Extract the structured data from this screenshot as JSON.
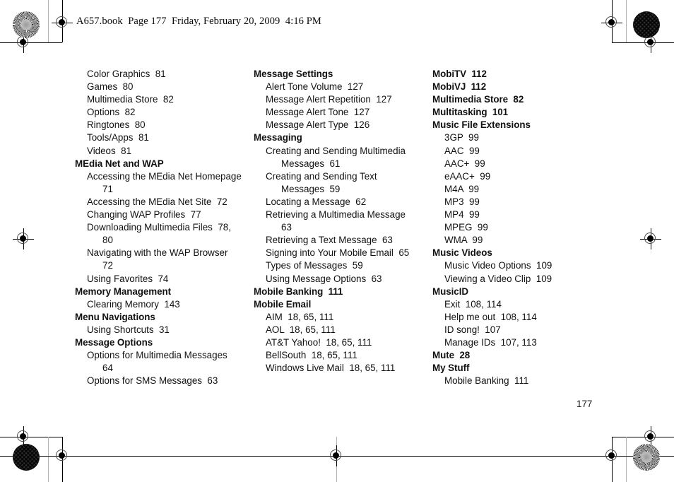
{
  "document": {
    "header_line": "A657.book  Page 177  Friday, February 20, 2009  4:16 PM",
    "page_number": "177"
  },
  "index": {
    "columns": [
      {
        "id": "column-1",
        "entries": [
          {
            "type": "sub",
            "text": "Color Graphics  81"
          },
          {
            "type": "sub",
            "text": "Games  80"
          },
          {
            "type": "sub",
            "text": "Multimedia Store  82"
          },
          {
            "type": "sub",
            "text": "Options  82"
          },
          {
            "type": "sub",
            "text": "Ringtones  80"
          },
          {
            "type": "sub",
            "text": "Tools/Apps  81"
          },
          {
            "type": "sub",
            "text": "Videos  81"
          },
          {
            "type": "heading",
            "text": "MEdia Net and WAP"
          },
          {
            "type": "sub",
            "text": "Accessing the MEdia Net Homepage",
            "cont": "71"
          },
          {
            "type": "sub",
            "text": "Accessing the MEdia Net Site  72"
          },
          {
            "type": "sub",
            "text": "Changing WAP Profiles  77"
          },
          {
            "type": "sub",
            "text": "Downloading Multimedia Files  78,",
            "cont": "80"
          },
          {
            "type": "sub",
            "text": "Navigating with the WAP Browser",
            "cont": "72"
          },
          {
            "type": "sub",
            "text": "Using Favorites  74"
          },
          {
            "type": "heading",
            "text": "Memory Management"
          },
          {
            "type": "sub",
            "text": "Clearing Memory  143"
          },
          {
            "type": "heading",
            "text": "Menu Navigations"
          },
          {
            "type": "sub",
            "text": "Using Shortcuts  31"
          },
          {
            "type": "heading",
            "text": "Message Options"
          },
          {
            "type": "sub",
            "text": "Options for Multimedia Messages",
            "cont": "64"
          },
          {
            "type": "sub",
            "text": "Options for SMS Messages  63"
          }
        ]
      },
      {
        "id": "column-2",
        "entries": [
          {
            "type": "heading",
            "text": "Message Settings"
          },
          {
            "type": "sub",
            "text": "Alert Tone Volume  127"
          },
          {
            "type": "sub",
            "text": "Message Alert Repetition  127"
          },
          {
            "type": "sub",
            "text": "Message Alert Tone  127"
          },
          {
            "type": "sub",
            "text": "Message Alert Type  126"
          },
          {
            "type": "heading",
            "text": "Messaging"
          },
          {
            "type": "sub",
            "text": "Creating and Sending Multimedia",
            "cont": "Messages  61"
          },
          {
            "type": "sub",
            "text": "Creating and Sending Text",
            "cont": "Messages  59"
          },
          {
            "type": "sub",
            "text": "Locating a Message  62"
          },
          {
            "type": "sub",
            "text": "Retrieving a Multimedia Message",
            "cont": "63"
          },
          {
            "type": "sub",
            "text": "Retrieving a Text Message  63"
          },
          {
            "type": "sub",
            "text": "Signing into Your Mobile Email  65"
          },
          {
            "type": "sub",
            "text": "Types of Messages  59"
          },
          {
            "type": "sub",
            "text": "Using Message Options  63"
          },
          {
            "type": "heading",
            "text": "Mobile Banking  111"
          },
          {
            "type": "heading",
            "text": "Mobile Email"
          },
          {
            "type": "sub",
            "text": "AIM  18, 65, 111"
          },
          {
            "type": "sub",
            "text": "AOL  18, 65, 111"
          },
          {
            "type": "sub",
            "text": "AT&T Yahoo!  18, 65, 111"
          },
          {
            "type": "sub",
            "text": "BellSouth  18, 65, 111"
          },
          {
            "type": "sub",
            "text": "Windows Live Mail  18, 65, 111"
          }
        ]
      },
      {
        "id": "column-3",
        "entries": [
          {
            "type": "heading",
            "text": "MobiTV  112"
          },
          {
            "type": "heading",
            "text": "MobiVJ  112"
          },
          {
            "type": "heading",
            "text": "Multimedia Store  82"
          },
          {
            "type": "heading",
            "text": "Multitasking  101"
          },
          {
            "type": "heading",
            "text": "Music File Extensions"
          },
          {
            "type": "sub",
            "text": "3GP  99"
          },
          {
            "type": "sub",
            "text": "AAC  99"
          },
          {
            "type": "sub",
            "text": "AAC+  99"
          },
          {
            "type": "sub",
            "text": "eAAC+  99"
          },
          {
            "type": "sub",
            "text": "M4A  99"
          },
          {
            "type": "sub",
            "text": "MP3  99"
          },
          {
            "type": "sub",
            "text": "MP4  99"
          },
          {
            "type": "sub",
            "text": "MPEG  99"
          },
          {
            "type": "sub",
            "text": "WMA  99"
          },
          {
            "type": "heading",
            "text": "Music Videos"
          },
          {
            "type": "sub",
            "text": "Music Video Options  109"
          },
          {
            "type": "sub",
            "text": "Viewing a Video Clip  109"
          },
          {
            "type": "heading",
            "text": "MusicID"
          },
          {
            "type": "sub",
            "text": "Exit  108, 114"
          },
          {
            "type": "sub",
            "text": "Help me out  108, 114"
          },
          {
            "type": "sub",
            "text": "ID song!  107"
          },
          {
            "type": "sub",
            "text": "Manage IDs  107, 113"
          },
          {
            "type": "heading",
            "text": "Mute  28"
          },
          {
            "type": "heading",
            "text": "My Stuff"
          },
          {
            "type": "sub",
            "text": "Mobile Banking  111"
          }
        ]
      }
    ]
  },
  "print_marks": {
    "registration_label": "registration-target",
    "star_label": "star-density-target",
    "maze_label": "resolution-target"
  }
}
